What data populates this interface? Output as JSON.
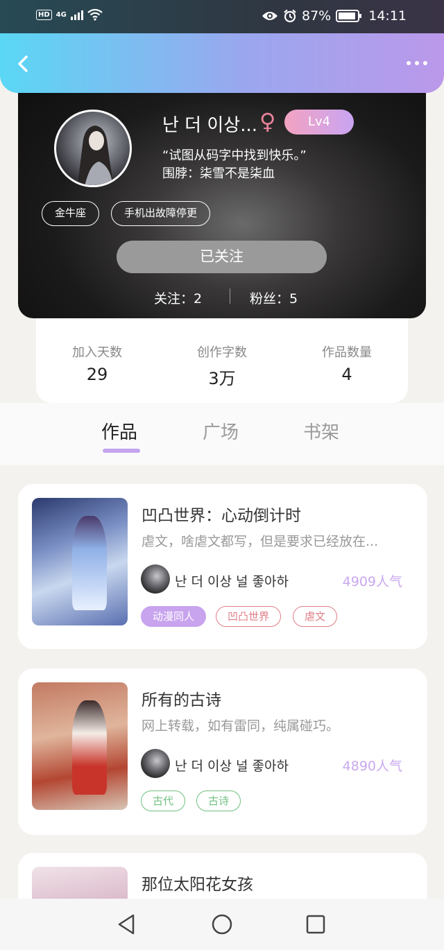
{
  "status_bar": {
    "hd": "HD",
    "network": "4G",
    "battery": "87%",
    "time": "14:11"
  },
  "profile": {
    "nickname": "난 더 이상...",
    "gender_symbol": "♀",
    "level": "Lv4",
    "motto": "“试图从码字中找到快乐。”",
    "scarf": "围脖：柒雪不是柒血",
    "tags": [
      "金牛座",
      "手机出故障停更"
    ],
    "follow_button": "已关注",
    "following": "关注：2",
    "fans": "粉丝：5"
  },
  "stats": [
    {
      "label": "加入天数",
      "value": "29"
    },
    {
      "label": "创作字数",
      "value": "3万"
    },
    {
      "label": "作品数量",
      "value": "4"
    }
  ],
  "tabs": [
    {
      "label": "作品",
      "active": true
    },
    {
      "label": "广场",
      "active": false
    },
    {
      "label": "书架",
      "active": false
    }
  ],
  "works": [
    {
      "title": "凹凸世界：心动倒计时",
      "desc": "虐文，啥虐文都写，但是要求已经放在...",
      "author": "난 더 이상 널 좋아하",
      "popularity": "4909人气",
      "tags": [
        {
          "label": "动漫同人",
          "style": "purple"
        },
        {
          "label": "凹凸世界",
          "style": "red"
        },
        {
          "label": "虐文",
          "style": "red"
        }
      ]
    },
    {
      "title": "所有的古诗",
      "desc": "网上转载，如有雷同，纯属碰巧。",
      "author": "난 더 이상 널 좋아하",
      "popularity": "4890人气",
      "tags": [
        {
          "label": "古代",
          "style": "green"
        },
        {
          "label": "古诗",
          "style": "green"
        }
      ]
    },
    {
      "title": "那位太阳花女孩"
    }
  ],
  "colors": {
    "accent_purple": "#c4a4ee",
    "header_gradient_start": "#5ad7f4",
    "header_gradient_end": "#bb98ea",
    "tag_red": "#e07d86",
    "tag_green": "#6fbf7f"
  },
  "icons": {
    "back": "chevron-left-icon",
    "more": "more-dots-icon",
    "nav_back": "triangle-back-icon",
    "nav_home": "circle-home-icon",
    "nav_recent": "square-recent-icon"
  }
}
